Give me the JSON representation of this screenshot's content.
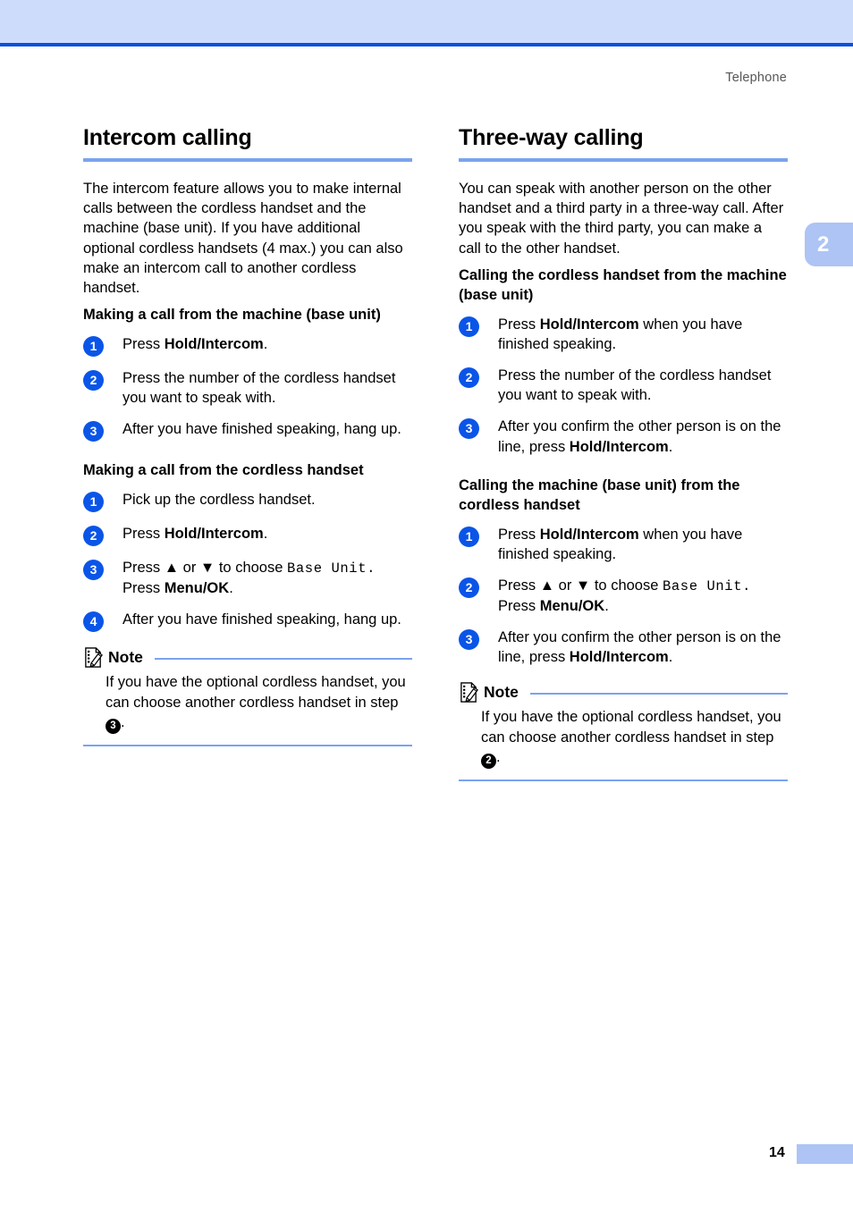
{
  "page": {
    "running_head": "Telephone",
    "chapter_tab": "2",
    "page_number": "14",
    "accent_blue": "#0a4de0",
    "band_blue": "#cedcfb",
    "rule_blue": "#7ba3ef",
    "tab_blue": "#adc4f5",
    "step_circle_blue": "#0a55e8"
  },
  "left": {
    "title": "Intercom calling",
    "intro": "The intercom feature allows you to make internal calls between the cordless handset and the machine (base unit). If you have additional optional cordless handsets (4 max.) you can also make an intercom call to another cordless handset.",
    "section1": {
      "heading": "Making a call from the machine (base unit)",
      "steps": [
        {
          "num": "1",
          "pre": "Press ",
          "bold": "Hold/Intercom",
          "post": "."
        },
        {
          "num": "2",
          "pre": "Press the number of the cordless handset you want to speak with.",
          "bold": "",
          "post": ""
        },
        {
          "num": "3",
          "pre": "After you have finished speaking, hang up.",
          "bold": "",
          "post": ""
        }
      ]
    },
    "section2": {
      "heading": "Making a call from the cordless handset",
      "steps": [
        {
          "num": "1",
          "pre": "Pick up the cordless handset.",
          "bold": "",
          "post": ""
        },
        {
          "num": "2",
          "pre": "Press ",
          "bold": "Hold/Intercom",
          "post": "."
        },
        {
          "num": "3",
          "pre": "Press ▲ or ▼ to choose ",
          "mono": "Base Unit.",
          "mid": " Press ",
          "bold2": "Menu/OK",
          "post": "."
        },
        {
          "num": "4",
          "pre": "After you have finished speaking, hang up.",
          "bold": "",
          "post": ""
        }
      ]
    },
    "note": {
      "label": "Note",
      "text_before": "If you have the optional cordless handset, you can choose another cordless handset in step ",
      "step_ref": "3",
      "text_after": "."
    }
  },
  "right": {
    "title": "Three-way calling",
    "intro": "You can speak with another person on the other handset and a third party in a three-way call. After you speak with the third party, you can make a call to the other handset.",
    "section1": {
      "heading": "Calling the cordless handset from the machine (base unit)",
      "steps": [
        {
          "num": "1",
          "pre": "Press ",
          "bold": "Hold/Intercom",
          "post": " when you have finished speaking."
        },
        {
          "num": "2",
          "pre": "Press the number of the cordless handset you want to speak with.",
          "bold": "",
          "post": ""
        },
        {
          "num": "3",
          "pre": "After you confirm the other person is on the line, press ",
          "bold": "Hold/Intercom",
          "post": "."
        }
      ]
    },
    "section2": {
      "heading": "Calling the machine (base unit) from the cordless handset",
      "steps": [
        {
          "num": "1",
          "pre": "Press ",
          "bold": "Hold/Intercom",
          "post": " when you have finished speaking."
        },
        {
          "num": "2",
          "pre": "Press ▲ or ▼ to choose ",
          "mono": "Base Unit.",
          "mid": " Press ",
          "bold2": "Menu/OK",
          "post": "."
        },
        {
          "num": "3",
          "pre": "After you confirm the other person is on the line, press ",
          "bold": "Hold/Intercom",
          "post": "."
        }
      ]
    },
    "note": {
      "label": "Note",
      "text_before": "If you have the optional cordless handset, you can choose another cordless handset in step ",
      "step_ref": "2",
      "text_after": "."
    }
  }
}
